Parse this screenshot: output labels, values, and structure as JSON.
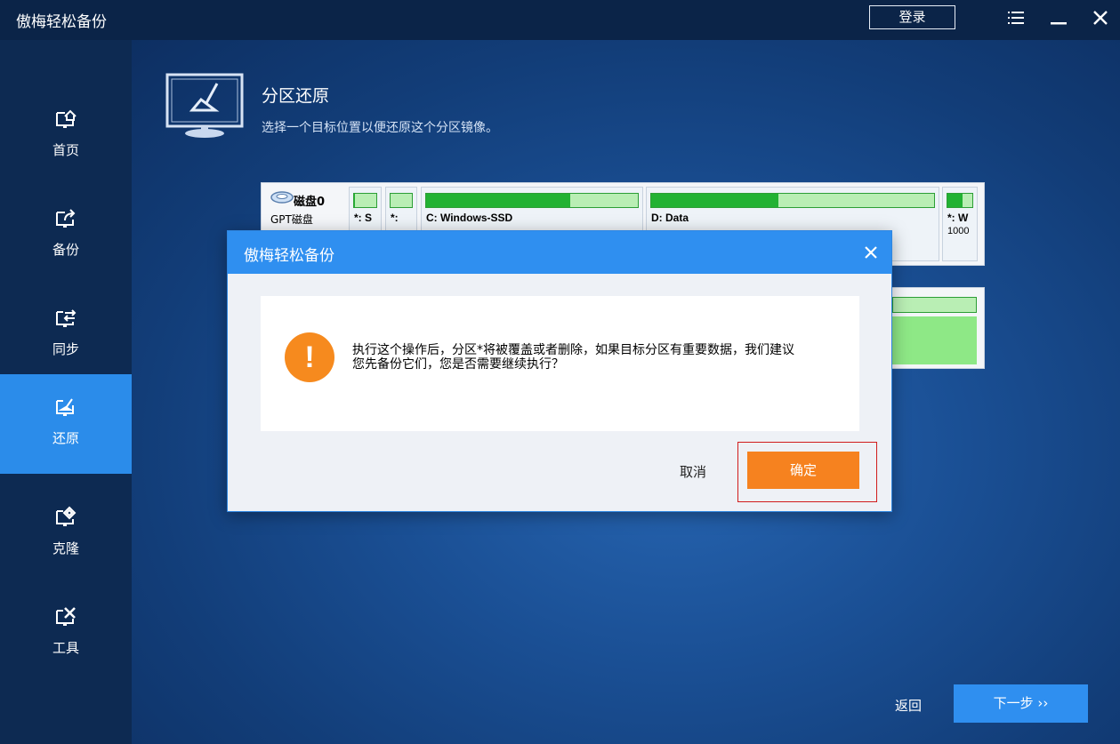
{
  "app": {
    "title": "傲梅轻松备份",
    "login_label": "登录"
  },
  "window_controls": [
    "menu-icon",
    "minimize-icon",
    "close-icon"
  ],
  "sidebar": {
    "items": [
      {
        "label": "首页",
        "icon": "home-icon"
      },
      {
        "label": "备份",
        "icon": "backup-icon"
      },
      {
        "label": "同步",
        "icon": "sync-icon"
      },
      {
        "label": "还原",
        "icon": "restore-icon",
        "active": true
      },
      {
        "label": "克隆",
        "icon": "clone-icon"
      },
      {
        "label": "工具",
        "icon": "tools-icon"
      }
    ]
  },
  "main": {
    "title": "分区还原",
    "subtitle": "选择一个目标位置以便还原这个分区镜像。"
  },
  "disk": {
    "name": "磁盘0",
    "type": "GPT磁盘",
    "partitions": [
      {
        "label": "*: S",
        "used_fraction": 0.05
      },
      {
        "label": "*:",
        "used_fraction": 0.0
      },
      {
        "label": "C: Windows-SSD",
        "used_fraction": 0.68
      },
      {
        "label": "D: Data",
        "used_fraction": 0.45
      },
      {
        "label": "*: W",
        "size_text": "1000",
        "used_fraction": 0.6
      }
    ]
  },
  "dialog": {
    "title": "傲梅轻松备份",
    "message_line1": "执行这个操作后，分区*将被覆盖或者删除，如果目标分区有重要数据，我们建议",
    "message_line2": "您先备份它们，您是否需要继续执行？",
    "warning_glyph": "!",
    "cancel_label": "取消",
    "ok_label": "确定"
  },
  "footer": {
    "back_label": "返回",
    "next_label": "下一步 ››"
  },
  "colors": {
    "accent": "#2f8ff0",
    "sidebar_active": "#2b8cea",
    "ok_button": "#f6821f",
    "highlight_border": "#d11c1c",
    "partition_fill": "#22b233"
  }
}
